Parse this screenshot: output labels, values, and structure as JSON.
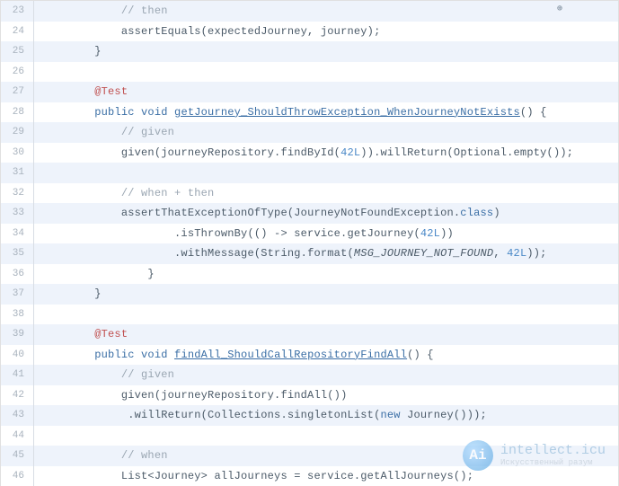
{
  "watermark": {
    "brand": "intellect.icu",
    "subtitle": "Искусственный разум",
    "badge": "Ai"
  },
  "glyph": "⊕",
  "lines": [
    {
      "num": 23,
      "indent": 3,
      "tokens": [
        {
          "t": "// then",
          "c": "c-comment"
        }
      ],
      "glyph": true
    },
    {
      "num": 24,
      "indent": 3,
      "tokens": [
        {
          "t": "assertEquals(expectedJourney, journey);",
          "c": ""
        }
      ]
    },
    {
      "num": 25,
      "indent": 2,
      "tokens": [
        {
          "t": "}",
          "c": ""
        }
      ]
    },
    {
      "num": 26,
      "indent": 0,
      "tokens": []
    },
    {
      "num": 27,
      "indent": 2,
      "tokens": [
        {
          "t": "@Test",
          "c": "c-annotation"
        }
      ]
    },
    {
      "num": 28,
      "indent": 2,
      "tokens": [
        {
          "t": "public ",
          "c": "c-keyword"
        },
        {
          "t": "void ",
          "c": "c-keyword"
        },
        {
          "t": "getJourney_ShouldThrowException_WhenJourneyNotExists",
          "c": "c-method"
        },
        {
          "t": "() {",
          "c": ""
        }
      ]
    },
    {
      "num": 29,
      "indent": 3,
      "tokens": [
        {
          "t": "// given",
          "c": "c-comment"
        }
      ]
    },
    {
      "num": 30,
      "indent": 3,
      "tokens": [
        {
          "t": "given(journeyRepository.findById(",
          "c": ""
        },
        {
          "t": "42L",
          "c": "c-number"
        },
        {
          "t": ")).willReturn(Optional.",
          "c": ""
        },
        {
          "t": "empty",
          "c": ""
        },
        {
          "t": "());",
          "c": ""
        }
      ]
    },
    {
      "num": 31,
      "indent": 0,
      "tokens": []
    },
    {
      "num": 32,
      "indent": 3,
      "tokens": [
        {
          "t": "// when + then",
          "c": "c-comment"
        }
      ]
    },
    {
      "num": 33,
      "indent": 3,
      "tokens": [
        {
          "t": "assertThatExceptionOfType",
          "c": ""
        },
        {
          "t": "(JourneyNotFoundException.",
          "c": ""
        },
        {
          "t": "class",
          "c": "c-keyword"
        },
        {
          "t": ")",
          "c": ""
        }
      ]
    },
    {
      "num": 34,
      "indent": 5,
      "tokens": [
        {
          "t": ".isThrownBy(() -> service.getJourney(",
          "c": ""
        },
        {
          "t": "42L",
          "c": "c-number"
        },
        {
          "t": "))",
          "c": ""
        }
      ]
    },
    {
      "num": 35,
      "indent": 5,
      "tokens": [
        {
          "t": ".withMessage(String.",
          "c": ""
        },
        {
          "t": "format",
          "c": ""
        },
        {
          "t": "(",
          "c": ""
        },
        {
          "t": "MSG_JOURNEY_NOT_FOUND",
          "c": "c-field"
        },
        {
          "t": ", ",
          "c": ""
        },
        {
          "t": "42L",
          "c": "c-number"
        },
        {
          "t": "));",
          "c": ""
        }
      ]
    },
    {
      "num": 36,
      "indent": 4,
      "tokens": [
        {
          "t": "}",
          "c": ""
        }
      ]
    },
    {
      "num": 37,
      "indent": 2,
      "tokens": [
        {
          "t": "}",
          "c": ""
        }
      ]
    },
    {
      "num": 38,
      "indent": 0,
      "tokens": []
    },
    {
      "num": 39,
      "indent": 2,
      "tokens": [
        {
          "t": "@Test",
          "c": "c-annotation"
        }
      ]
    },
    {
      "num": 40,
      "indent": 2,
      "tokens": [
        {
          "t": "public ",
          "c": "c-keyword"
        },
        {
          "t": "void ",
          "c": "c-keyword"
        },
        {
          "t": "findAll_ShouldCallRepositoryFindAll",
          "c": "c-method"
        },
        {
          "t": "() {",
          "c": ""
        }
      ]
    },
    {
      "num": 41,
      "indent": 3,
      "tokens": [
        {
          "t": "// given",
          "c": "c-comment"
        }
      ]
    },
    {
      "num": 42,
      "indent": 3,
      "tokens": [
        {
          "t": "given(journeyRepository.findAll())",
          "c": ""
        }
      ]
    },
    {
      "num": 43,
      "indent": 3,
      "tokens": [
        {
          "t": " .willReturn(Collections.",
          "c": ""
        },
        {
          "t": "singletonList",
          "c": ""
        },
        {
          "t": "(",
          "c": ""
        },
        {
          "t": "new ",
          "c": "c-new"
        },
        {
          "t": "Journey()));",
          "c": ""
        }
      ]
    },
    {
      "num": 44,
      "indent": 0,
      "tokens": []
    },
    {
      "num": 45,
      "indent": 3,
      "tokens": [
        {
          "t": "// when",
          "c": "c-comment"
        }
      ]
    },
    {
      "num": 46,
      "indent": 3,
      "tokens": [
        {
          "t": "List<Journey> allJourneys = service.getAllJourneys();",
          "c": ""
        }
      ]
    }
  ]
}
